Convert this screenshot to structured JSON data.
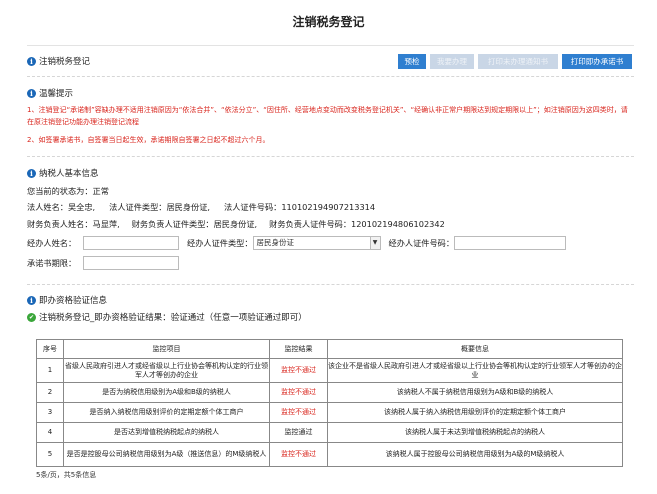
{
  "page_title": "注销税务登记",
  "section_main": {
    "title": "注销税务登记"
  },
  "toolbar": {
    "btn_precheck": "预检",
    "btn_handle": "我要办理",
    "btn_print_no_handle": "打印未办理通知书",
    "btn_print_immediate": "打印即办承诺书"
  },
  "notice": {
    "title": "温馨提示",
    "line1": "1、注销登记“承诺制”容缺办理不适用注销原因为“依法合并”、“依法分立”、“因住所、经营地点变动而改变税务登记机关”、“经确认非正常户期限达到规定期限以上”；如注销原因为这四类时，请在原注销登记功能办理注销登记流程",
    "line2": "2、如签署承诺书，自签署当日起生效，承诺期限自签署之日起不超过六个月。"
  },
  "taxpayer": {
    "title": "纳税人基本信息",
    "status_label": "您当前的状态为：",
    "status_value": "正常",
    "legal_name_label": "法人姓名：",
    "legal_name": "吴全忠,",
    "legal_id_type_label": "法人证件类型：",
    "legal_id_type": "居民身份证,",
    "legal_id_no_label": "法人证件号码：",
    "legal_id_no": "110102194907213314",
    "fin_name_label": "财务负责人姓名：",
    "fin_name": "马显萍,",
    "fin_id_type_label": "财务负责人证件类型：",
    "fin_id_type": "居民身份证,",
    "fin_id_no_label": "财务负责人证件号码：",
    "fin_id_no": "120102194806102342",
    "agent_name_label": "经办人姓名：",
    "agent_name_value": "",
    "agent_id_type_label": "经办人证件类型：",
    "agent_id_type_value": "居民身份证",
    "agent_id_no_label": "经办人证件号码：",
    "agent_id_no_value": "",
    "promise_label": "承诺书期限：",
    "promise_value": ""
  },
  "qualification": {
    "title": "即办资格验证信息",
    "result_text": "注销税务登记_即办资格验证结果：验证通过（任意一项验证通过即可）"
  },
  "table": {
    "headers": [
      "序号",
      "监控项目",
      "监控结果",
      "概要信息"
    ],
    "rows": [
      {
        "no": "1",
        "item": "省级人民政府引进人才或经省级以上行业协会等机构认定的行业领军人才等创办的企业",
        "result": "监控不通过",
        "info": "该企业不是省级人民政府引进人才或经省级以上行业协会等机构认定的行业领军人才等创办的企业"
      },
      {
        "no": "2",
        "item": "是否为纳税信用级别为A级和B级的纳税人",
        "result": "监控不通过",
        "info": "该纳税人不属于纳税信用级别为A级和B级的纳税人"
      },
      {
        "no": "3",
        "item": "是否纳入纳税信用级别评价的定期定额个体工商户",
        "result": "监控不通过",
        "info": "该纳税人属于纳入纳税信用级别评价的定期定额个体工商户"
      },
      {
        "no": "4",
        "item": "是否达到增值税纳税起点的纳税人",
        "result": "监控通过",
        "info": "该纳税人属于未达到增值税纳税起点的纳税人"
      },
      {
        "no": "5",
        "item": "是否是控股母公司纳税信用级别为A级（推送信息）的M级纳税人",
        "result": "监控不通过",
        "info": "该纳税人属于控股母公司纳税信用级别为A级的M级纳税人"
      }
    ],
    "footer": "5条/页，共5条信息"
  },
  "colors": {
    "accent": "#2f7fd0",
    "warning": "#d9251d",
    "success": "#3aa63a"
  },
  "icons": {
    "info": "info-circle-icon",
    "check": "check-circle-icon"
  }
}
